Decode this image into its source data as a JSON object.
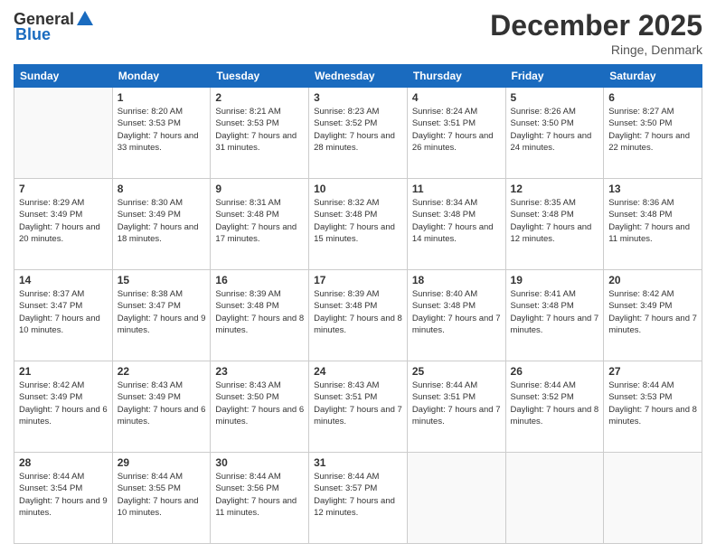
{
  "header": {
    "logo": {
      "general": "General",
      "blue": "Blue"
    },
    "title": "December 2025",
    "location": "Ringe, Denmark"
  },
  "weekdays": [
    "Sunday",
    "Monday",
    "Tuesday",
    "Wednesday",
    "Thursday",
    "Friday",
    "Saturday"
  ],
  "weeks": [
    [
      {
        "day": null
      },
      {
        "day": 1,
        "sunrise": "8:20 AM",
        "sunset": "3:53 PM",
        "daylight": "7 hours and 33 minutes."
      },
      {
        "day": 2,
        "sunrise": "8:21 AM",
        "sunset": "3:53 PM",
        "daylight": "7 hours and 31 minutes."
      },
      {
        "day": 3,
        "sunrise": "8:23 AM",
        "sunset": "3:52 PM",
        "daylight": "7 hours and 28 minutes."
      },
      {
        "day": 4,
        "sunrise": "8:24 AM",
        "sunset": "3:51 PM",
        "daylight": "7 hours and 26 minutes."
      },
      {
        "day": 5,
        "sunrise": "8:26 AM",
        "sunset": "3:50 PM",
        "daylight": "7 hours and 24 minutes."
      },
      {
        "day": 6,
        "sunrise": "8:27 AM",
        "sunset": "3:50 PM",
        "daylight": "7 hours and 22 minutes."
      }
    ],
    [
      {
        "day": 7,
        "sunrise": "8:29 AM",
        "sunset": "3:49 PM",
        "daylight": "7 hours and 20 minutes."
      },
      {
        "day": 8,
        "sunrise": "8:30 AM",
        "sunset": "3:49 PM",
        "daylight": "7 hours and 18 minutes."
      },
      {
        "day": 9,
        "sunrise": "8:31 AM",
        "sunset": "3:48 PM",
        "daylight": "7 hours and 17 minutes."
      },
      {
        "day": 10,
        "sunrise": "8:32 AM",
        "sunset": "3:48 PM",
        "daylight": "7 hours and 15 minutes."
      },
      {
        "day": 11,
        "sunrise": "8:34 AM",
        "sunset": "3:48 PM",
        "daylight": "7 hours and 14 minutes."
      },
      {
        "day": 12,
        "sunrise": "8:35 AM",
        "sunset": "3:48 PM",
        "daylight": "7 hours and 12 minutes."
      },
      {
        "day": 13,
        "sunrise": "8:36 AM",
        "sunset": "3:48 PM",
        "daylight": "7 hours and 11 minutes."
      }
    ],
    [
      {
        "day": 14,
        "sunrise": "8:37 AM",
        "sunset": "3:47 PM",
        "daylight": "7 hours and 10 minutes."
      },
      {
        "day": 15,
        "sunrise": "8:38 AM",
        "sunset": "3:47 PM",
        "daylight": "7 hours and 9 minutes."
      },
      {
        "day": 16,
        "sunrise": "8:39 AM",
        "sunset": "3:48 PM",
        "daylight": "7 hours and 8 minutes."
      },
      {
        "day": 17,
        "sunrise": "8:39 AM",
        "sunset": "3:48 PM",
        "daylight": "7 hours and 8 minutes."
      },
      {
        "day": 18,
        "sunrise": "8:40 AM",
        "sunset": "3:48 PM",
        "daylight": "7 hours and 7 minutes."
      },
      {
        "day": 19,
        "sunrise": "8:41 AM",
        "sunset": "3:48 PM",
        "daylight": "7 hours and 7 minutes."
      },
      {
        "day": 20,
        "sunrise": "8:42 AM",
        "sunset": "3:49 PM",
        "daylight": "7 hours and 7 minutes."
      }
    ],
    [
      {
        "day": 21,
        "sunrise": "8:42 AM",
        "sunset": "3:49 PM",
        "daylight": "7 hours and 6 minutes."
      },
      {
        "day": 22,
        "sunrise": "8:43 AM",
        "sunset": "3:49 PM",
        "daylight": "7 hours and 6 minutes."
      },
      {
        "day": 23,
        "sunrise": "8:43 AM",
        "sunset": "3:50 PM",
        "daylight": "7 hours and 6 minutes."
      },
      {
        "day": 24,
        "sunrise": "8:43 AM",
        "sunset": "3:51 PM",
        "daylight": "7 hours and 7 minutes."
      },
      {
        "day": 25,
        "sunrise": "8:44 AM",
        "sunset": "3:51 PM",
        "daylight": "7 hours and 7 minutes."
      },
      {
        "day": 26,
        "sunrise": "8:44 AM",
        "sunset": "3:52 PM",
        "daylight": "7 hours and 8 minutes."
      },
      {
        "day": 27,
        "sunrise": "8:44 AM",
        "sunset": "3:53 PM",
        "daylight": "7 hours and 8 minutes."
      }
    ],
    [
      {
        "day": 28,
        "sunrise": "8:44 AM",
        "sunset": "3:54 PM",
        "daylight": "7 hours and 9 minutes."
      },
      {
        "day": 29,
        "sunrise": "8:44 AM",
        "sunset": "3:55 PM",
        "daylight": "7 hours and 10 minutes."
      },
      {
        "day": 30,
        "sunrise": "8:44 AM",
        "sunset": "3:56 PM",
        "daylight": "7 hours and 11 minutes."
      },
      {
        "day": 31,
        "sunrise": "8:44 AM",
        "sunset": "3:57 PM",
        "daylight": "7 hours and 12 minutes."
      },
      {
        "day": null
      },
      {
        "day": null
      },
      {
        "day": null
      }
    ]
  ]
}
